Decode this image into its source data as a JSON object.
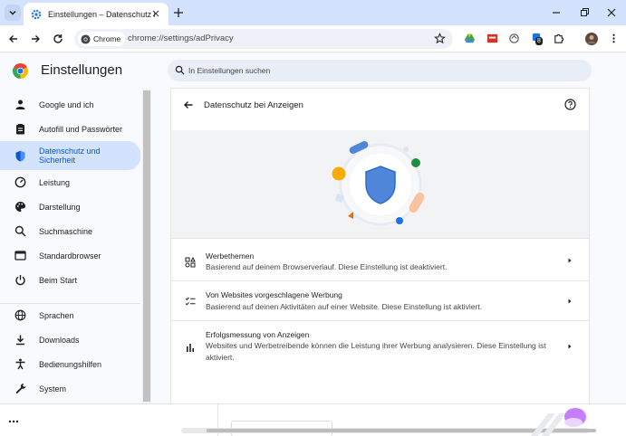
{
  "browser": {
    "tab_title": "Einstellungen – Datenschutz bei Anzeigen",
    "chip_label": "Chrome",
    "url": "chrome://settings/adPrivacy",
    "extension_badge": "8"
  },
  "icons": {
    "tab_search": "chevron-down-icon",
    "tab": "gear-icon",
    "back": "arrow-left-icon",
    "forward": "arrow-right-icon",
    "reload": "reload-icon",
    "bookmark": "star-icon",
    "help": "help-circle-icon"
  },
  "colors": {
    "accent": "#0b57d0",
    "tabstrip": "#d3e3fd",
    "active_item_bg": "#d3e3fd",
    "shield": "#4f86d9"
  },
  "settings": {
    "title": "Einstellungen",
    "search_placeholder": "In Einstellungen suchen"
  },
  "sidebar": {
    "items": [
      {
        "label": "Google und ich",
        "icon": "person-icon"
      },
      {
        "label": "Autofill und Passwörter",
        "icon": "clipboard-icon"
      },
      {
        "label": "Datenschutz und Sicherheit",
        "icon": "shield-icon",
        "active": true
      },
      {
        "label": "Leistung",
        "icon": "speedometer-icon"
      },
      {
        "label": "Darstellung",
        "icon": "palette-icon"
      },
      {
        "label": "Suchmaschine",
        "icon": "search-icon"
      },
      {
        "label": "Standardbrowser",
        "icon": "browser-icon"
      },
      {
        "label": "Beim Start",
        "icon": "power-icon"
      },
      {
        "label": "Sprachen",
        "icon": "globe-icon"
      },
      {
        "label": "Downloads",
        "icon": "download-icon"
      },
      {
        "label": "Bedienungshilfen",
        "icon": "accessibility-icon"
      },
      {
        "label": "System",
        "icon": "wrench-icon"
      }
    ]
  },
  "page": {
    "title": "Datenschutz bei Anzeigen",
    "rows": [
      {
        "title": "Werbethemen",
        "desc": "Basierend auf deinem Browserverlauf. Diese Einstellung ist deaktiviert.",
        "icon": "topics-icon"
      },
      {
        "title": "Von Websites vorgeschlagene Werbung",
        "desc": "Basierend auf deinen Aktivitäten auf einer Website. Diese Einstellung ist aktiviert.",
        "icon": "checklist-icon"
      },
      {
        "title": "Erfolgsmessung von Anzeigen",
        "desc": "Websites und Werbetreibende können die Leistung ihrer Werbung analysieren. Diese Einstellung ist aktiviert.",
        "icon": "bar-chart-icon"
      }
    ]
  }
}
